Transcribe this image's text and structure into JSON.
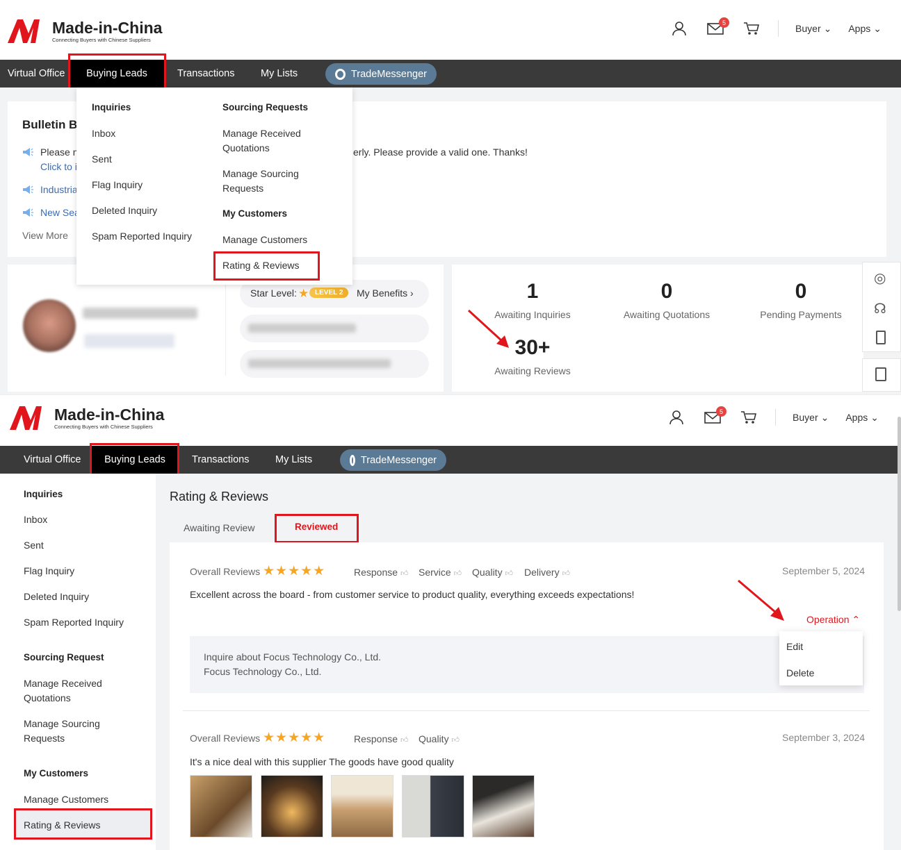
{
  "brand": {
    "title": "Made-in-China",
    "tagline": "Connecting Buyers with Chinese Suppliers",
    "registered": "®"
  },
  "header": {
    "mail_badge": "5",
    "buyer_label": "Buyer",
    "apps_label": "Apps"
  },
  "nav": {
    "virtual_office": "Virtual Office",
    "buying_leads": "Buying Leads",
    "transactions": "Transactions",
    "my_lists": "My Lists",
    "trade_messenger": "TradeMessenger"
  },
  "bulletin": {
    "title": "Bulletin B",
    "line1a": "Please n",
    "line1b": "Click to i",
    "line1_tail": "erly. Please provide a valid one. Thanks!",
    "line2": "Industria",
    "line3": "New Sea",
    "view_more": "View More"
  },
  "dropdown": {
    "inquiries_head": "Inquiries",
    "inbox": "Inbox",
    "sent": "Sent",
    "flag": "Flag Inquiry",
    "deleted": "Deleted Inquiry",
    "spam": "Spam Reported Inquiry",
    "sourcing_head": "Sourcing Requests",
    "manage_received_1": "Manage Received",
    "manage_received_2": "Quotations",
    "manage_sourcing_1": "Manage Sourcing",
    "manage_sourcing_2": "Requests",
    "customers_head": "My Customers",
    "manage_customers": "Manage Customers",
    "rating_reviews": "Rating & Reviews"
  },
  "profile": {
    "star_level_label": "Star Level:",
    "level_badge": "LEVEL 2",
    "my_benefits": "My Benefits"
  },
  "stats": {
    "awaiting_inquiries_num": "1",
    "awaiting_inquiries": "Awaiting Inquiries",
    "awaiting_quotations_num": "0",
    "awaiting_quotations": "Awaiting Quotations",
    "pending_payments_num": "0",
    "pending_payments": "Pending Payments",
    "awaiting_reviews_num": "30+",
    "awaiting_reviews": "Awaiting Reviews"
  },
  "sidebar": {
    "inquiries_head": "Inquiries",
    "inbox": "Inbox",
    "sent": "Sent",
    "flag": "Flag Inquiry",
    "deleted": "Deleted Inquiry",
    "spam": "Spam Reported Inquiry",
    "sourcing_head": "Sourcing Request",
    "manage_received_1": "Manage Received",
    "manage_received_2": "Quotations",
    "manage_sourcing_1": "Manage Sourcing",
    "manage_sourcing_2": "Requests",
    "customers_head": "My Customers",
    "manage_customers": "Manage Customers",
    "rating_reviews": "Rating & Reviews"
  },
  "reviews_page": {
    "title": "Rating & Reviews",
    "tab_awaiting": "Awaiting Review",
    "tab_reviewed": "Reviewed",
    "overall_label": "Overall Reviews",
    "stars": "★★★★★",
    "review1": {
      "tags": [
        "Response",
        "Service",
        "Quality",
        "Delivery"
      ],
      "date": "September 5, 2024",
      "text": "Excellent across the board - from customer service to product quality, everything exceeds expectations!",
      "operation": "Operation",
      "inquire_line": "Inquire about Focus Technology Co., Ltd.",
      "company": "Focus Technology Co., Ltd.",
      "menu_edit": "Edit",
      "menu_delete": "Delete"
    },
    "review2": {
      "tags": [
        "Response",
        "Quality"
      ],
      "date": "September 3, 2024",
      "text": "It's a nice deal with this supplier The goods have good quality",
      "photo_count": 5
    }
  },
  "colors": {
    "accent_red": "#e0161c",
    "nav_bg": "#3a3a3a",
    "star": "#f5a623",
    "link_blue": "#3a6bb5",
    "messenger_pill": "#5b7a95"
  }
}
